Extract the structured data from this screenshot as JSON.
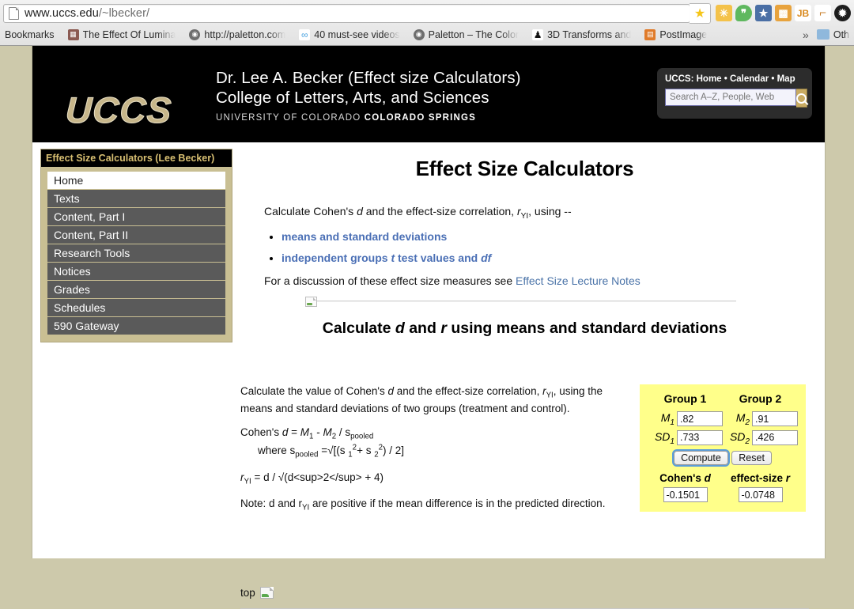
{
  "browser": {
    "url_main": "www.uccs.edu",
    "url_path": "/~lbecker/",
    "page_icon": "document-icon",
    "bookmark_star": "★",
    "overflow_chevron": "»",
    "toolbar_icons": [
      {
        "name": "puzzle-extension-icon",
        "glyph": "✳",
        "bg": "#f4c24a",
        "fg": "#ffffff"
      },
      {
        "name": "hangouts-icon",
        "glyph": "❞",
        "bg": "#5fb85f",
        "fg": "#ffffff"
      },
      {
        "name": "star-extension-icon",
        "glyph": "★",
        "bg": "#4a6fa5",
        "fg": "#ffffff"
      },
      {
        "name": "boxes-extension-icon",
        "glyph": "▩",
        "bg": "#e8a33d",
        "fg": "#ffffff"
      },
      {
        "name": "jb-extension-icon",
        "glyph": "JB",
        "bg": "#ffffff",
        "fg": "#d98a1f"
      },
      {
        "name": "ruler-extension-icon",
        "glyph": "⌐",
        "bg": "#ffffff",
        "fg": "#c87f2a"
      },
      {
        "name": "settings-gear-icon",
        "glyph": "✹",
        "bg": "#1d1d1d",
        "fg": "#ffffff"
      }
    ],
    "bookmarks_label": "Bookmarks",
    "bookmarks": [
      {
        "label": "The Effect Of Lumina",
        "favicon": "grid-icon",
        "color": "#8b5a52"
      },
      {
        "label": "http://paletton.com",
        "favicon": "globe-pin-icon",
        "color": "#6e6e6e"
      },
      {
        "label": "40 must-see videos",
        "favicon": "link-icon",
        "color": "#ffffff"
      },
      {
        "label": "Paletton – The Color",
        "favicon": "globe-pin-icon",
        "color": "#6e6e6e"
      },
      {
        "label": "3D Transforms and ",
        "favicon": "penguin-icon",
        "color": "#ffffff"
      },
      {
        "label": "PostImage",
        "favicon": "images-icon",
        "color": "#e07b2a"
      }
    ],
    "other_bookmarks": "Oth"
  },
  "header": {
    "logo_text": "UCCS",
    "title_line1": "Dr. Lee A. Becker (Effect size Calculators)",
    "title_line2": "College of Letters, Arts, and Sciences",
    "subtitle_plain": "UNIVERSITY OF COLORADO ",
    "subtitle_bold": "COLORADO SPRINGS",
    "nav_links": "UCCS: Home • Calendar • Map",
    "search_placeholder": "Search A–Z, People, Web",
    "search_value": "",
    "search_button_icon": "magnifier-icon"
  },
  "sidebar": {
    "title": "Effect Size Calculators (Lee Becker)",
    "items": [
      {
        "label": "Home",
        "active": true
      },
      {
        "label": "Texts",
        "active": false
      },
      {
        "label": "Content, Part I",
        "active": false
      },
      {
        "label": "Content, Part II",
        "active": false
      },
      {
        "label": "Research Tools",
        "active": false
      },
      {
        "label": "Notices",
        "active": false
      },
      {
        "label": "Grades",
        "active": false
      },
      {
        "label": "Schedules",
        "active": false
      },
      {
        "label": "590 Gateway",
        "active": false
      }
    ]
  },
  "main": {
    "page_title": "Effect Size Calculators",
    "intro_pre": "Calculate Cohen's ",
    "intro_d": "d",
    "intro_mid": " and the effect-size correlation, ",
    "intro_r": "r",
    "intro_r_sub": "YI",
    "intro_post": ", using --",
    "link_means": "means and standard deviations",
    "link_groups_a": "independent groups ",
    "link_groups_t": "t",
    "link_groups_b": " test values and ",
    "link_groups_df": "df",
    "discussion_text": "For a discussion of these effect size measures see ",
    "discussion_link": "Effect Size Lecture Notes",
    "section_title_a": "Calculate ",
    "section_title_d": "d",
    "section_title_b": " and ",
    "section_title_r": "r",
    "section_title_c": " using means and standard deviations",
    "explain_p1_a": "Calculate the value of Cohen's ",
    "explain_p1_d": "d",
    "explain_p1_b": " and the effect-size correlation, ",
    "explain_p1_r": "r",
    "explain_p1_rsub": "YI",
    "explain_p1_c": ", using the means and standard deviations of two groups (treatment and control).",
    "formula_d_a": "Cohen's ",
    "formula_d_i": "d",
    "formula_d_b": " = ",
    "formula_M1": "M",
    "formula_M1_sub": "1",
    "formula_minus": " - ",
    "formula_M2": "M",
    "formula_M2_sub": "2",
    "formula_div": " / s",
    "formula_pooled": "pooled",
    "formula_where": "where s",
    "formula_where_sub": "pooled",
    "formula_where_b": " =√[(s ",
    "formula_s1_sub": "1",
    "formula_s1_sup": "2",
    "formula_plus": "+ s ",
    "formula_s2_sub": "2",
    "formula_s2_sup": "2",
    "formula_where_c": ") / 2]",
    "formula_r_a": "r",
    "formula_r_sub": "YI",
    "formula_r_b": " = d / √(d<sup>2</sup> + 4)",
    "note_a": "Note: d and r",
    "note_sub": "YI",
    "note_b": " are positive if the mean difference is in the predicted direction.",
    "top_link": "top",
    "broken_image_icon": "broken-image-icon"
  },
  "calculator": {
    "group1_label": "Group 1",
    "group2_label": "Group 2",
    "m1_label": "M",
    "m1_sub": "1",
    "m1_value": ".82",
    "m2_label": "M",
    "m2_sub": "2",
    "m2_value": ".91",
    "sd1_label": "SD",
    "sd1_sub": "1",
    "sd1_value": ".733",
    "sd2_label": "SD",
    "sd2_sub": "2",
    "sd2_value": ".426",
    "compute_label": "Compute",
    "reset_label": "Reset",
    "cohens_d_label_a": "Cohen's ",
    "cohens_d_label_i": "d",
    "effect_r_label_a": "effect-size ",
    "effect_r_label_i": "r",
    "cohens_d_value": "-0.1501",
    "effect_r_value": "-0.0748",
    "background_color": "#ffff8a"
  }
}
